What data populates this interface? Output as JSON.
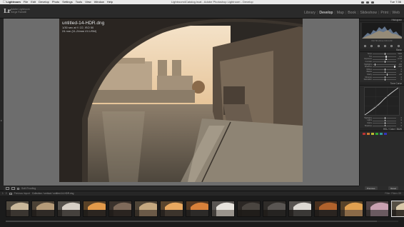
{
  "menubar": {
    "apple": "",
    "items": [
      "Lightroom",
      "File",
      "Edit",
      "Develop",
      "Photo",
      "Settings",
      "Tools",
      "View",
      "Window",
      "Help"
    ],
    "window_title": "Lightroom4Catalog.lrcat - Adobe Photoshop Lightroom - Develop",
    "clock": "Tue 7:36"
  },
  "identity": {
    "logo": "Lr",
    "line1": "Adobe Lightroom",
    "line2": "Serge Ramelli"
  },
  "modules": [
    {
      "label": "Library",
      "active": false
    },
    {
      "label": "Develop",
      "active": true
    },
    {
      "label": "Map",
      "active": false
    },
    {
      "label": "Book",
      "active": false
    },
    {
      "label": "Slideshow",
      "active": false
    },
    {
      "label": "Print",
      "active": false
    },
    {
      "label": "Web",
      "active": false
    }
  ],
  "info_overlay": {
    "filename": "untitled-14-HDR.dng",
    "line2": "1/30 sec at f / 22, ISO 50",
    "line3": "24 mm (11-24mm f/4 USM)"
  },
  "toolbar": {
    "soft_proofing": "Soft Proofing"
  },
  "right_panel": {
    "histogram_label": "Histogram",
    "hist_meta": "ISO 50   24mm   f/22   1/30",
    "basic_label": "Basic",
    "tone_curve_label": "Tone Curve",
    "sliders": [
      {
        "label": "Temp",
        "value": "5200",
        "pos": 0.5
      },
      {
        "label": "Tint",
        "value": "+12",
        "pos": 0.55
      },
      {
        "label": "Exposure",
        "value": "+0.30",
        "pos": 0.55
      },
      {
        "label": "Contrast",
        "value": "0",
        "pos": 0.5
      },
      {
        "label": "Highlights",
        "value": "-100",
        "pos": 0.08
      },
      {
        "label": "Shadows",
        "value": "+100",
        "pos": 0.92
      },
      {
        "label": "Whites",
        "value": "0",
        "pos": 0.5
      },
      {
        "label": "Blacks",
        "value": "0",
        "pos": 0.5
      },
      {
        "label": "Clarity",
        "value": "+20",
        "pos": 0.6
      },
      {
        "label": "Vibrance",
        "value": "0",
        "pos": 0.5
      },
      {
        "label": "Saturation",
        "value": "0",
        "pos": 0.5
      }
    ],
    "curve_sliders": [
      {
        "label": "Highlights",
        "value": "0",
        "pos": 0.5
      },
      {
        "label": "Lights",
        "value": "0",
        "pos": 0.5
      },
      {
        "label": "Darks",
        "value": "0",
        "pos": 0.5
      },
      {
        "label": "Shadows",
        "value": "0",
        "pos": 0.5
      }
    ],
    "hsl_label": "HSL / Color / B&W",
    "previous_button": "Previous",
    "reset_button": "Reset"
  },
  "filmstrip_bar": {
    "page_1": "1",
    "page_2": "2",
    "prev_import": "Previous Import",
    "crumb": "Collection / vertical / untitled-14-HDR.dng",
    "filter": "Filter: Filters Off"
  },
  "thumbs": [
    {
      "sky": "#c9b79a",
      "ground": "#3a3530"
    },
    {
      "sky": "#b49a78",
      "ground": "#2f2a26"
    },
    {
      "sky": "#d6cfc6",
      "ground": "#45413d"
    },
    {
      "sky": "#e29a4a",
      "ground": "#2b2520"
    },
    {
      "sky": "#7e6a5a",
      "ground": "#2a2420"
    },
    {
      "sky": "#c4a880",
      "ground": "#6b5a48"
    },
    {
      "sky": "#e8a860",
      "ground": "#3c342c"
    },
    {
      "sky": "#d8813a",
      "ground": "#2c2a28"
    },
    {
      "sky": "#e6e2dc",
      "ground": "#9a948d"
    },
    {
      "sky": "#4a4540",
      "ground": "#201d1a"
    },
    {
      "sky": "#595552",
      "ground": "#252321"
    },
    {
      "sky": "#dcd8d2",
      "ground": "#3a3836"
    },
    {
      "sky": "#b0622c",
      "ground": "#2a2420"
    },
    {
      "sky": "#e0a050",
      "ground": "#8a6a48"
    },
    {
      "sky": "#c8a0b0",
      "ground": "#6a5a60"
    },
    {
      "sky": "#d8c8a8",
      "ground": "#3a342c"
    }
  ],
  "selected_thumb": 15,
  "colors": {
    "menubar_bg": "#e9e9e9",
    "panel_bg": "#2a2a2a",
    "canvas_bg": "#6d6d6d",
    "active_module": "#f0f0f0"
  }
}
